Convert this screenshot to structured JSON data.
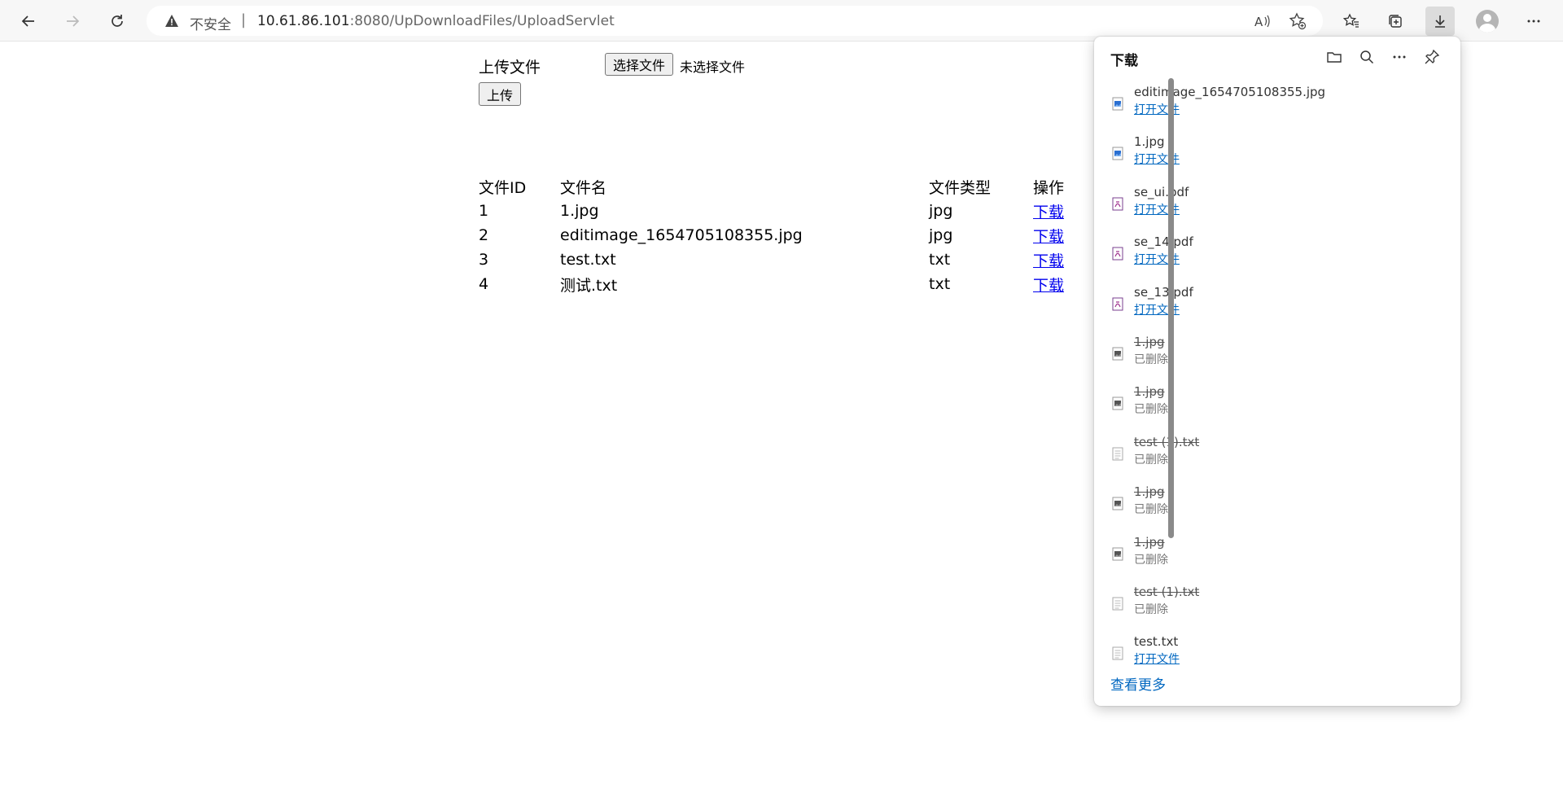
{
  "browser": {
    "security_label": "不安全",
    "url_host": "10.61.86.101",
    "url_rest": ":8080/UpDownloadFiles/UploadServlet"
  },
  "upload": {
    "label": "上传文件",
    "choose_button": "选择文件",
    "no_file_text": "未选择文件",
    "submit_button": "上传"
  },
  "table": {
    "headers": [
      "文件ID",
      "文件名",
      "文件类型",
      "操作"
    ],
    "rows": [
      {
        "id": "1",
        "name": "1.jpg",
        "type": "jpg",
        "action": "下载"
      },
      {
        "id": "2",
        "name": "editimage_1654705108355.jpg",
        "type": "jpg",
        "action": "下载"
      },
      {
        "id": "3",
        "name": "test.txt",
        "type": "txt",
        "action": "下载"
      },
      {
        "id": "4",
        "name": "测试.txt",
        "type": "txt",
        "action": "下载"
      }
    ]
  },
  "downloads": {
    "title": "下载",
    "see_more": "查看更多",
    "items": [
      {
        "name": "editimage_1654705108355.jpg",
        "status": "打开文件",
        "kind": "image",
        "deleted": false
      },
      {
        "name": "1.jpg",
        "status": "打开文件",
        "kind": "image",
        "deleted": false
      },
      {
        "name": "se_ui.pdf",
        "status": "打开文件",
        "kind": "pdf",
        "deleted": false
      },
      {
        "name": "se_14.pdf",
        "status": "打开文件",
        "kind": "pdf",
        "deleted": false
      },
      {
        "name": "se_13.pdf",
        "status": "打开文件",
        "kind": "pdf",
        "deleted": false
      },
      {
        "name": "1.jpg",
        "status": "已删除",
        "kind": "image-gray",
        "deleted": true
      },
      {
        "name": "1.jpg",
        "status": "已删除",
        "kind": "image-gray",
        "deleted": true
      },
      {
        "name": "test (1).txt",
        "status": "已删除",
        "kind": "text",
        "deleted": true
      },
      {
        "name": "1.jpg",
        "status": "已删除",
        "kind": "image-gray",
        "deleted": true
      },
      {
        "name": "1.jpg",
        "status": "已删除",
        "kind": "image-gray",
        "deleted": true
      },
      {
        "name": "test (1).txt",
        "status": "已删除",
        "kind": "text",
        "deleted": true
      },
      {
        "name": "test.txt",
        "status": "打开文件",
        "kind": "text",
        "deleted": false
      }
    ]
  }
}
